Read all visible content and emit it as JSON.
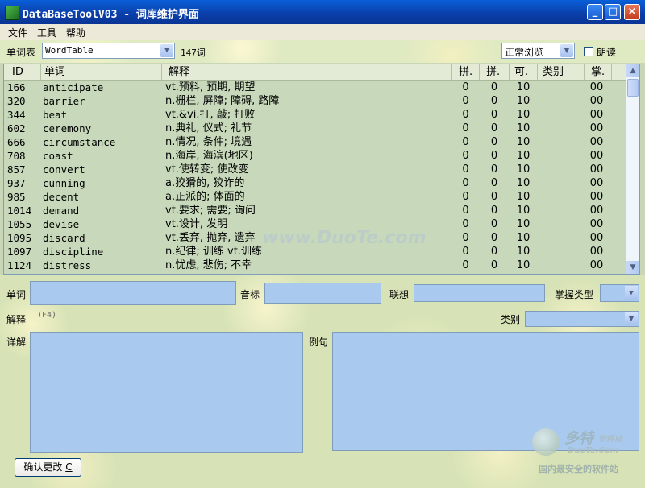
{
  "window": {
    "title": "DataBaseToolV03 - 词库维护界面",
    "buttons": [
      "_",
      "□",
      "×"
    ]
  },
  "menu": [
    "文件",
    "工具",
    "帮助"
  ],
  "toolbar": {
    "table_label": "单词表",
    "table_value": "WordTable",
    "word_count": "147词",
    "view_mode": "正常浏览",
    "read_aloud_label": "朗读"
  },
  "grid": {
    "columns": [
      "ID",
      "单词",
      "解释",
      "拼.",
      "拼.",
      "可.",
      "类别",
      "掌."
    ],
    "rows": [
      {
        "id": "166",
        "word": "anticipate",
        "def": "vt.预料, 预期, 期望",
        "p1": "0",
        "p2": "0",
        "k": "10",
        "cat": "",
        "m": "00"
      },
      {
        "id": "320",
        "word": "barrier",
        "def": "n.栅栏, 屏障; 障碍, 路障",
        "p1": "0",
        "p2": "0",
        "k": "10",
        "cat": "",
        "m": "00"
      },
      {
        "id": "344",
        "word": "beat",
        "def": "vt.&vi.打, 敲; 打败",
        "p1": "0",
        "p2": "0",
        "k": "10",
        "cat": "",
        "m": "00"
      },
      {
        "id": "602",
        "word": "ceremony",
        "def": "n.典礼, 仪式; 礼节",
        "p1": "0",
        "p2": "0",
        "k": "10",
        "cat": "",
        "m": "00"
      },
      {
        "id": "666",
        "word": "circumstance",
        "def": "n.情况, 条件; 境遇",
        "p1": "0",
        "p2": "0",
        "k": "10",
        "cat": "",
        "m": "00"
      },
      {
        "id": "708",
        "word": "coast",
        "def": "n.海岸, 海滨(地区)",
        "p1": "0",
        "p2": "0",
        "k": "10",
        "cat": "",
        "m": "00"
      },
      {
        "id": "857",
        "word": "convert",
        "def": "vt.使转变; 使改变",
        "p1": "0",
        "p2": "0",
        "k": "10",
        "cat": "",
        "m": "00"
      },
      {
        "id": "937",
        "word": "cunning",
        "def": "a.狡猾的, 狡诈的",
        "p1": "0",
        "p2": "0",
        "k": "10",
        "cat": "",
        "m": "00"
      },
      {
        "id": "985",
        "word": "decent",
        "def": "a.正派的; 体面的",
        "p1": "0",
        "p2": "0",
        "k": "10",
        "cat": "",
        "m": "00"
      },
      {
        "id": "1014",
        "word": "demand",
        "def": "vt.要求; 需要; 询问",
        "p1": "0",
        "p2": "0",
        "k": "10",
        "cat": "",
        "m": "00"
      },
      {
        "id": "1055",
        "word": "devise",
        "def": "vt.设计, 发明",
        "p1": "0",
        "p2": "0",
        "k": "10",
        "cat": "",
        "m": "00"
      },
      {
        "id": "1095",
        "word": "discard",
        "def": "vt.丢弃, 抛弃, 遗弃",
        "p1": "0",
        "p2": "0",
        "k": "10",
        "cat": "",
        "m": "00"
      },
      {
        "id": "1097",
        "word": "discipline",
        "def": "n.纪律; 训练 vt.训练",
        "p1": "0",
        "p2": "0",
        "k": "10",
        "cat": "",
        "m": "00"
      },
      {
        "id": "1124",
        "word": "distress",
        "def": "n.忧虑, 悲伤; 不幸",
        "p1": "0",
        "p2": "0",
        "k": "10",
        "cat": "",
        "m": "00"
      }
    ]
  },
  "form": {
    "word_label": "单词",
    "phonetic_label": "音标",
    "assoc_label": "联想",
    "mastery_label": "掌握类型",
    "def_label": "解释",
    "def_hint": "(F4)",
    "category_label": "类别",
    "detail_label": "详解",
    "example_label": "例句",
    "confirm_label": "确认更改",
    "confirm_key": "C"
  },
  "watermarks": {
    "center": "www.DuoTe.com",
    "logo_cn": "多特",
    "logo_cn_suffix": "软件站",
    "logo_en": "DuoTe.Com",
    "slogan": "国内最安全的软件站"
  },
  "colors": {
    "titlebar": "#0a3ea8",
    "grid_bg": "#c7d9ba",
    "field_bg": "#a9c9ee"
  }
}
